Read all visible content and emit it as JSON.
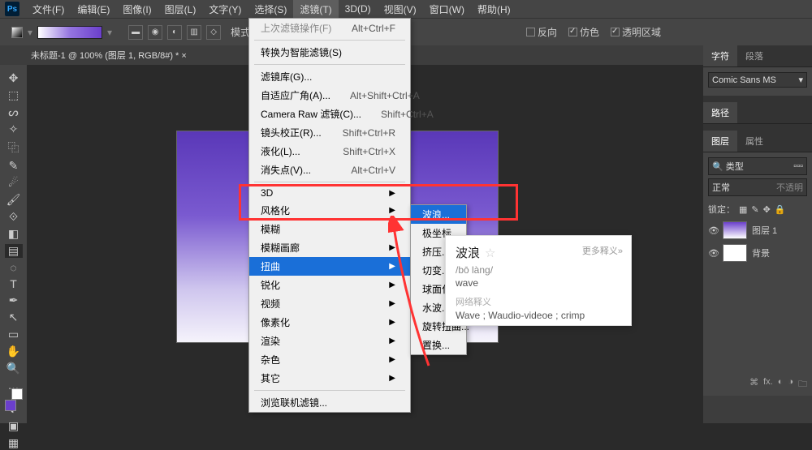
{
  "menubar": {
    "items": [
      "文件(F)",
      "编辑(E)",
      "图像(I)",
      "图层(L)",
      "文字(Y)",
      "选择(S)",
      "滤镜(T)",
      "3D(D)",
      "视图(V)",
      "窗口(W)",
      "帮助(H)"
    ],
    "active_index": 6
  },
  "optionsbar": {
    "mode_label": "模式：",
    "reverse": "反向",
    "dither": "仿色",
    "transparency": "透明区域"
  },
  "doc_tab": "未标题-1 @ 100% (图层 1, RGB/8#) * ×",
  "filter_menu": {
    "last": "上次滤镜操作(F)",
    "last_sc": "Alt+Ctrl+F",
    "smart": "转换为智能滤镜(S)",
    "gallery": "滤镜库(G)...",
    "adaptive": "自适应广角(A)...",
    "adaptive_sc": "Alt+Shift+Ctrl+A",
    "camera": "Camera Raw 滤镜(C)...",
    "camera_sc": "Shift+Ctrl+A",
    "lens": "镜头校正(R)...",
    "lens_sc": "Shift+Ctrl+R",
    "liquify": "液化(L)...",
    "liquify_sc": "Shift+Ctrl+X",
    "vanish": "消失点(V)...",
    "vanish_sc": "Alt+Ctrl+V",
    "groups": [
      "3D",
      "风格化",
      "模糊",
      "模糊画廊",
      "扭曲",
      "锐化",
      "视频",
      "像素化",
      "渲染",
      "杂色",
      "其它"
    ],
    "browse": "浏览联机滤镜..."
  },
  "submenu": {
    "items": [
      "波浪...",
      "极坐标...",
      "挤压...",
      "切变...",
      "球面化...",
      "水波...",
      "旋转扭曲...",
      "置换..."
    ],
    "hl_index": 0
  },
  "dict": {
    "word": "波浪",
    "star": "☆",
    "more": "更多释义»",
    "pron": "/bō làng/",
    "def": "wave",
    "net_label": "网络释义",
    "net": "Wave ; Waudio-videoe ; crimp"
  },
  "panels": {
    "char_tabs": [
      "字符",
      "段落"
    ],
    "font": "Comic Sans MS",
    "paths_tab": "路径",
    "layer_tabs": [
      "图层",
      "属性"
    ],
    "kind_label": "类型",
    "blend": "正常",
    "opacity": "不透明",
    "lock_label": "锁定：",
    "layers": [
      {
        "name": "图层 1",
        "thumb": "grad"
      },
      {
        "name": "背景",
        "thumb": "white"
      }
    ],
    "footer": "fx."
  },
  "icons": {
    "move": "✥",
    "marquee": "⬚",
    "lasso": "ᔕ",
    "wand": "✧",
    "crop": "⿻",
    "eyedrop": "✎",
    "brush": "🖌",
    "heal": "☄",
    "stamp": "⟐",
    "grad": "▤",
    "eraser": "◧",
    "blur": "◌",
    "type": "T",
    "pen": "✒",
    "path": "↖",
    "shape": "▭",
    "hand": "✋",
    "zoom": "🔍",
    "edit": "…",
    "qm": "◐",
    "view": "▣",
    "more": "▦"
  }
}
